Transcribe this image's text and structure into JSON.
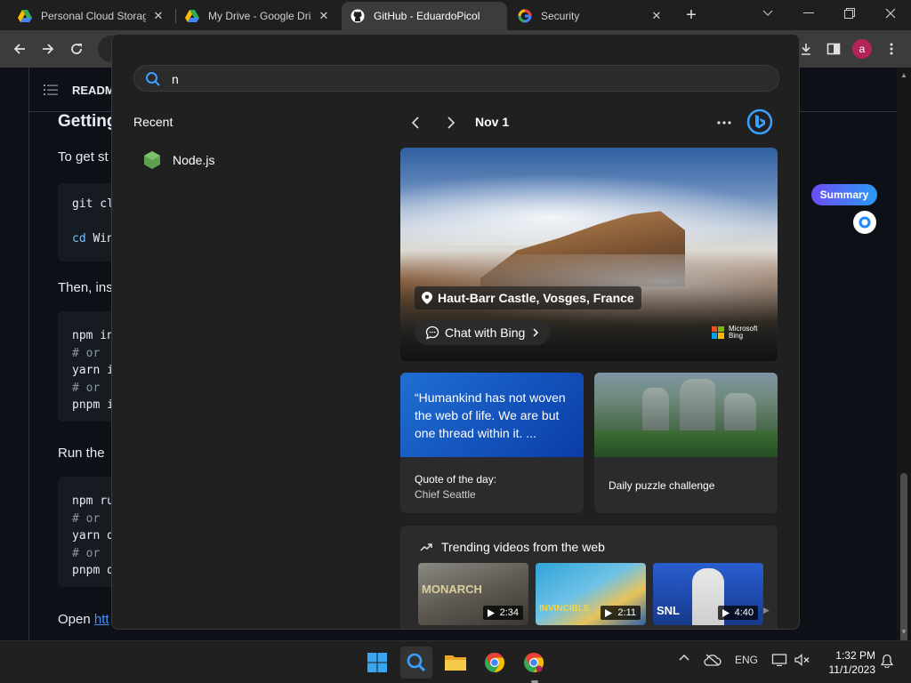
{
  "browser": {
    "tabs": [
      {
        "label": "Personal Cloud Storag",
        "icon": "google-drive-icon"
      },
      {
        "label": "My Drive - Google Dri",
        "icon": "google-drive-icon"
      },
      {
        "label": "GitHub - EduardoPicol",
        "icon": "github-icon"
      },
      {
        "label": "Security",
        "icon": "google-icon"
      }
    ],
    "new_tab_label": "+",
    "profile_initial": "a"
  },
  "github": {
    "section_label": "READM",
    "heading": "Getting",
    "para1": "To get st",
    "code1": [
      "git cl",
      "cd",
      "Win"
    ],
    "para2": "Then, ins",
    "code2": [
      "npm in",
      "# or",
      "yarn i",
      "# or",
      "pnpm i"
    ],
    "para3": "Run the",
    "code3": [
      "npm ru",
      "# or",
      "yarn d",
      "# or",
      "pnpm d"
    ],
    "para4": "Open",
    "para4_link": "htt"
  },
  "extension": {
    "summary_label": "Summary"
  },
  "search": {
    "query": "n",
    "recent_heading": "Recent",
    "recent_items": [
      {
        "label": "Node.js",
        "icon": "nodejs-icon"
      }
    ],
    "date_label": "Nov 1",
    "hero": {
      "location": "Haut-Barr Castle, Vosges, France",
      "chat_label": "Chat with Bing",
      "brand_line1": "Microsoft",
      "brand_line2": "Bing"
    },
    "quote_card": {
      "text": "“Humankind has not woven the web of life. We are but one thread within it. ...",
      "title": "Quote of the day:",
      "author": "Chief Seattle"
    },
    "puzzle_card": {
      "title": "Daily puzzle challenge"
    },
    "trending": {
      "heading": "Trending videos from the web",
      "videos": [
        {
          "label": "MONARCH",
          "duration": "2:34"
        },
        {
          "label": "INVINCIBLE",
          "duration": "2:11"
        },
        {
          "label": "SNL",
          "duration": "4:40"
        }
      ]
    }
  },
  "taskbar": {
    "language": "ENG",
    "time": "1:32 PM",
    "date": "11/1/2023"
  },
  "colors": {
    "accent_blue": "#1f6fd3",
    "summary_gradient_start": "#6c4df6",
    "summary_gradient_end": "#2a9bf6",
    "github_bg": "#0d1117"
  }
}
